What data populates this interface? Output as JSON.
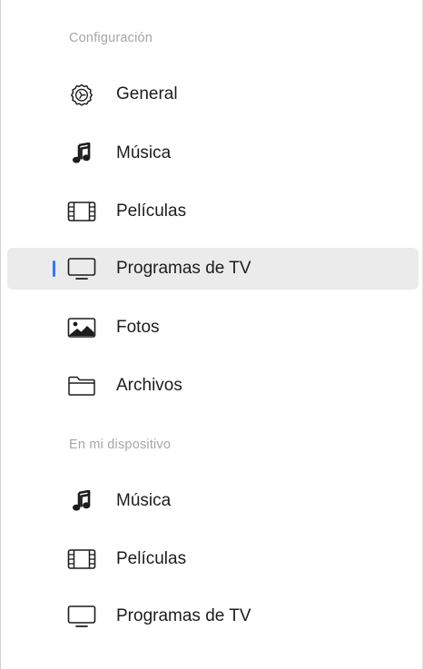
{
  "accent_color": "#3478f6",
  "sections": [
    {
      "header": "Configuración",
      "items": [
        {
          "label": "General",
          "icon": "gear-icon",
          "selected": false
        },
        {
          "label": "Música",
          "icon": "music-note-icon",
          "selected": false
        },
        {
          "label": "Películas",
          "icon": "film-icon",
          "selected": false
        },
        {
          "label": "Programas de TV",
          "icon": "tv-icon",
          "selected": true
        },
        {
          "label": "Fotos",
          "icon": "photo-icon",
          "selected": false
        },
        {
          "label": "Archivos",
          "icon": "folder-icon",
          "selected": false
        }
      ]
    },
    {
      "header": "En mi dispositivo",
      "items": [
        {
          "label": "Música",
          "icon": "music-note-icon",
          "selected": false
        },
        {
          "label": "Películas",
          "icon": "film-icon",
          "selected": false
        },
        {
          "label": "Programas de TV",
          "icon": "tv-icon",
          "selected": false
        }
      ]
    }
  ]
}
